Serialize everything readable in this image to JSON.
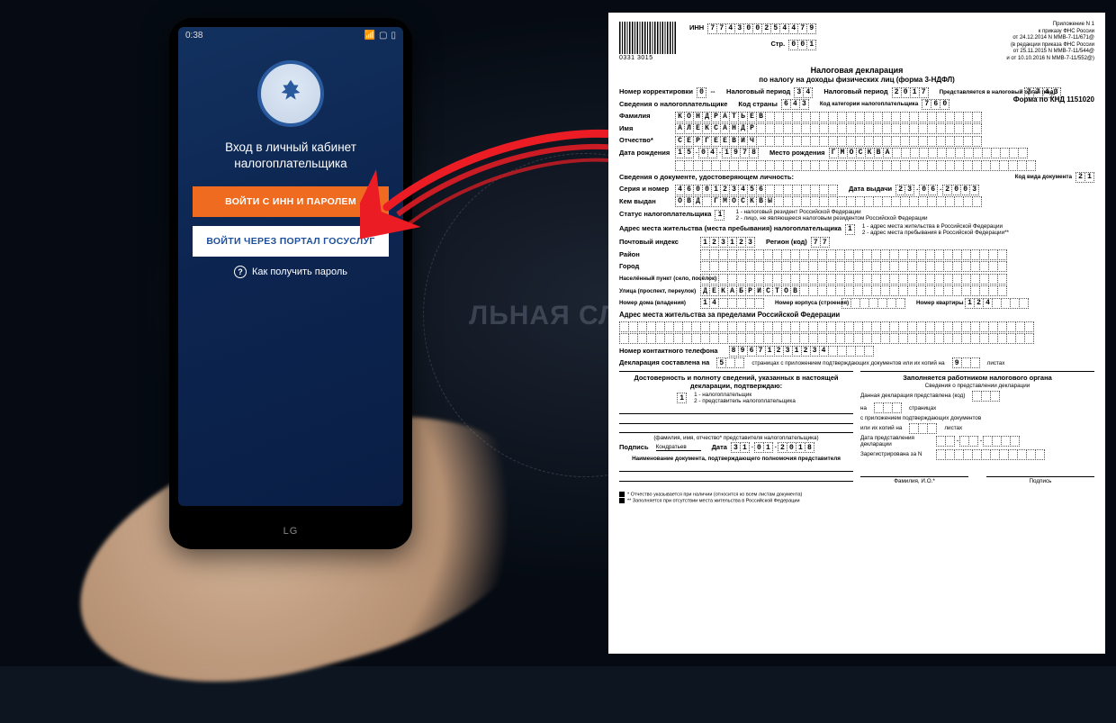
{
  "phone": {
    "statusbar_time": "0:38",
    "brand": "LG",
    "heading": "Вход в личный кабинет налогоплательщика",
    "btn_primary": "ВОЙТИ С ИНН И ПАРОЛЕМ",
    "btn_secondary": "ВОЙТИ ЧЕРЕЗ ПОРТАЛ ГОСУСЛУГ",
    "help": "Как получить пароль"
  },
  "bg_emblem_text": "ЛЬНАЯ\nСЛУЖБА",
  "doc": {
    "barcode": "0331 3015",
    "inn_label": "ИНН",
    "inn": "774300254479",
    "page_label": "Стр.",
    "page": "001",
    "appx": [
      "Приложение N 1",
      "к приказу ФНС России",
      "от 24.12.2014 N ММВ-7-11/671@",
      "(в редакции приказа ФНС России",
      "от 25.11.2015 N ММВ-7-11/544@",
      "и от 10.10.2016 N ММВ-7-11/552@)"
    ],
    "title": "Налоговая декларация",
    "subtitle": "по налогу на доходы физических лиц (форма 3-НДФЛ)",
    "knd": "Форма по КНД 1151020",
    "corr_label": "Номер корректировки",
    "corr": "0",
    "period_type_label": "Налоговый период",
    "period_type": "34",
    "period_label": "Налоговый период",
    "period": "2017",
    "organ_label": "Представляется в налоговый орган (код)",
    "organ": "7743",
    "sved_label": "Сведения о налогоплательщике",
    "country_label": "Код страны",
    "country": "643",
    "cat_label": "Код категории налогоплательщика",
    "cat": "760",
    "lastname_label": "Фамилия",
    "lastname": "КОНДРАТЬЕВ",
    "firstname_label": "Имя",
    "firstname": "АЛЕКСАНДР",
    "patronymic_label": "Отчество*",
    "patronymic": "СЕРГЕЕВИЧ",
    "dob_label": "Дата рождения",
    "dob": "15.04.1978",
    "pob_label": "Место рождения",
    "pob": "Г.МОСКВА",
    "iddoc_label": "Сведения о документе, удостоверяющем личность:",
    "doctype_label": "Код вида документа",
    "doctype": "21",
    "serial_label": "Серия и номер",
    "serial": "46 00 123456",
    "issue_date_label": "Дата выдачи",
    "issue_date": "23.06.2003",
    "issuer_label": "Кем выдан",
    "issuer": "ОВД Г.МОСКВЫ",
    "status_label": "Статус налогоплательщика",
    "status": "1",
    "status_note": "1 - налоговый резидент Российской Федерации\n2 - лицо, не являющееся налоговым резидентом Российской Федерации",
    "addr_label": "Адрес места жительства (места пребывания) налогоплательщика",
    "addr_flag": "1",
    "addr_note": "1 - адрес места жительства в Российской Федерации\n2 - адрес места пребывания в Российской Федерации**",
    "zip_label": "Почтовый индекс",
    "zip": "123123",
    "region_label": "Регион (код)",
    "region": "77",
    "district_label": "Район",
    "city_label": "Город",
    "settlement_label": "Населённый пункт (село, посёлок)",
    "street_label": "Улица (проспект, переулок)",
    "street": "ДЕКАБРИСТОВ",
    "house_label": "Номер дома (владения)",
    "house": "14",
    "korpus_label": "Номер корпуса (строения)",
    "flat_label": "Номер квартиры",
    "flat": "124",
    "abroad_label": "Адрес места жительства за пределами Российской Федерации",
    "phone_label": "Номер контактного телефона",
    "phone": "89671231234",
    "compiled_label": "Декларация составлена на",
    "compiled_pages": "5",
    "compiled_note": "страницах с приложением подтверждающих документов или их копий на",
    "attach_sheets": "9",
    "attach_note": "листах",
    "left_title": "Достоверность и полноту сведений, указанных в настоящей декларации, подтверждаю:",
    "left_flag": "1",
    "left_flag_note": "1 - налогоплательщик\n2 - представитель налогоплательщика",
    "sign_name": "Кондратьев",
    "sign_label": "Подпись",
    "date_label": "Дата",
    "sign_date": "31.01.2018",
    "rep_fio_note": "(фамилия, имя, отчество* представителя налогоплательщика)",
    "rep_doc_title": "Наименование документа, подтверждающего полномочия представителя",
    "right_title": "Заполняется работником налогового органа",
    "right_sub": "Сведения о представлении декларации",
    "right_code": "Данная декларация представлена (код)",
    "right_pages": "страницах",
    "right_on": "на",
    "right_attach": "с приложением подтверждающих документов",
    "right_copies": "или их копий на",
    "right_sheets": "листах",
    "right_date": "Дата представления декларации",
    "right_reg": "Зарегистрирована за N",
    "right_fio": "Фамилия, И.О.*",
    "right_sign": "Подпись",
    "foot1": "* Отчество указывается при наличии (относится ко всем листам документа)",
    "foot2": "** Заполняется при отсутствии места жительства в Российской Федерации"
  }
}
